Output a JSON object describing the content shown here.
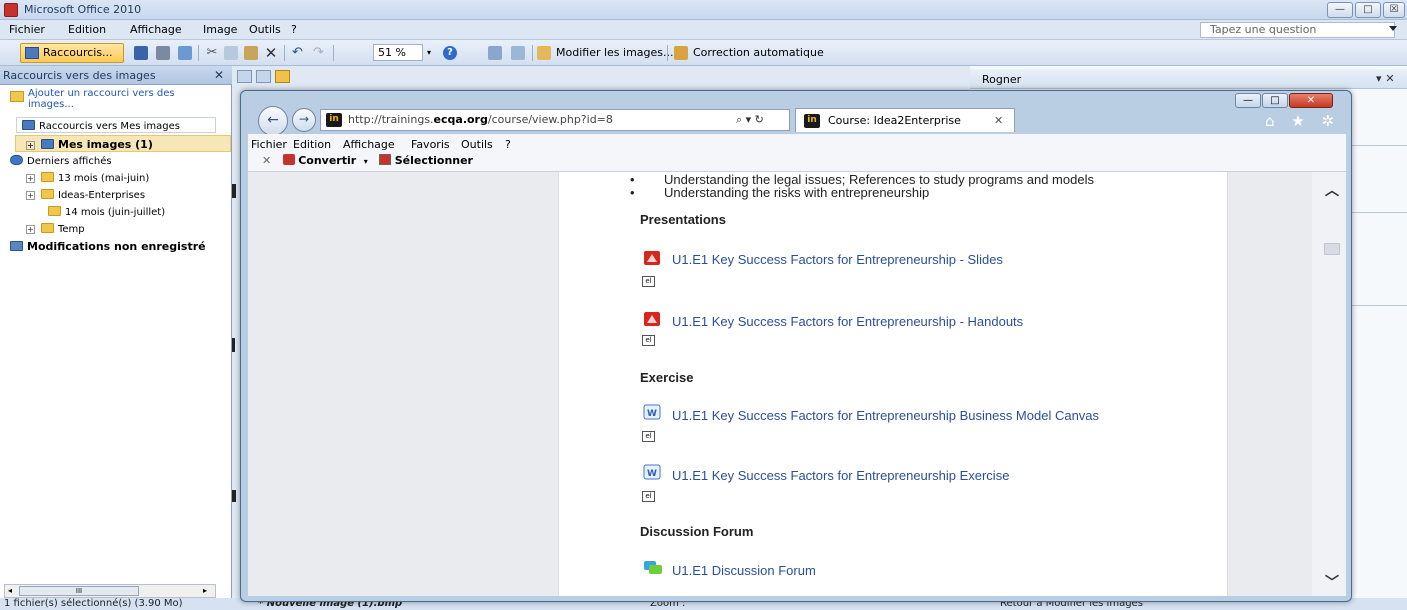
{
  "window": {
    "title": "Microsoft Office 2010",
    "minimize": "—",
    "maximize": "□",
    "close": "☒"
  },
  "menu": {
    "items": [
      "Fichier",
      "Edition",
      "Affichage",
      "Image",
      "Outils",
      "?"
    ],
    "ask_placeholder": "Tapez une question"
  },
  "toolbar": {
    "shortcuts_label": "Raccourcis...",
    "zoom_value": "51 %",
    "edit_images_label": "Modifier les images...",
    "auto_correct_label": "Correction automatique"
  },
  "left_panel": {
    "header": "Raccourcis vers des images",
    "close": "✕",
    "add_shortcut": "Ajouter un raccourci vers des images...",
    "tree": [
      {
        "label": "Raccourcis vers Mes images",
        "bold": false
      },
      {
        "label": "Mes images (1)",
        "bold": true
      },
      {
        "label": "Derniers affichés",
        "bold": false
      },
      {
        "label": "13 mois (mai-juin)",
        "bold": false
      },
      {
        "label": "Ideas-Enterprises",
        "bold": false
      },
      {
        "label": "14 mois (juin-juillet)",
        "bold": false
      },
      {
        "label": "Temp",
        "bold": false
      },
      {
        "label": "Modifications non enregistré",
        "bold": true
      }
    ],
    "scroll_mid": "III"
  },
  "status": {
    "selection": "1 fichier(s) sélectionné(s) (3.90 Mo)",
    "image_name": "* Nouvelle image (1).bmp",
    "zoom_label": "Zoom :",
    "bottom_right": "Retour à Modifier les images"
  },
  "right_panel": {
    "title": "Rogner",
    "close": "▾ ✕"
  },
  "browser": {
    "url_prefix": "http://trainings.",
    "url_domain": "ecqa.org",
    "url_suffix": "/course/view.php?id=8",
    "search_reload": "⌕ ▾ ↻",
    "favicon": "in",
    "tab_title": "Course: Idea2Enterprise",
    "tab_close": "✕",
    "top_icons": "⌂ ★ ✲",
    "menu": [
      "Fichier",
      "Edition",
      "Affichage",
      "Favoris",
      "Outils",
      "?"
    ],
    "tool_close": "✕",
    "tool_convert": "Convertir",
    "tool_select": "Sélectionner",
    "win_controls": [
      "—",
      "□",
      "✕"
    ]
  },
  "content": {
    "bullets": [
      "Understanding the legal issues; References to study programs and models",
      "Understanding the risks with entrepreneurship"
    ],
    "sections": {
      "presentations": "Presentations",
      "exercise": "Exercise",
      "forum": "Discussion Forum"
    },
    "resources": [
      "U1.E1 Key Success Factors for Entrepreneurship - Slides",
      "U1.E1 Key Success Factors for Entrepreneurship - Handouts",
      "U1.E1 Key Success Factors for Entrepreneurship Business Model Canvas",
      "U1.E1 Key Success Factors for Entrepreneurship Exercise",
      "U1.E1 Discussion Forum"
    ],
    "el_badge": "el"
  }
}
